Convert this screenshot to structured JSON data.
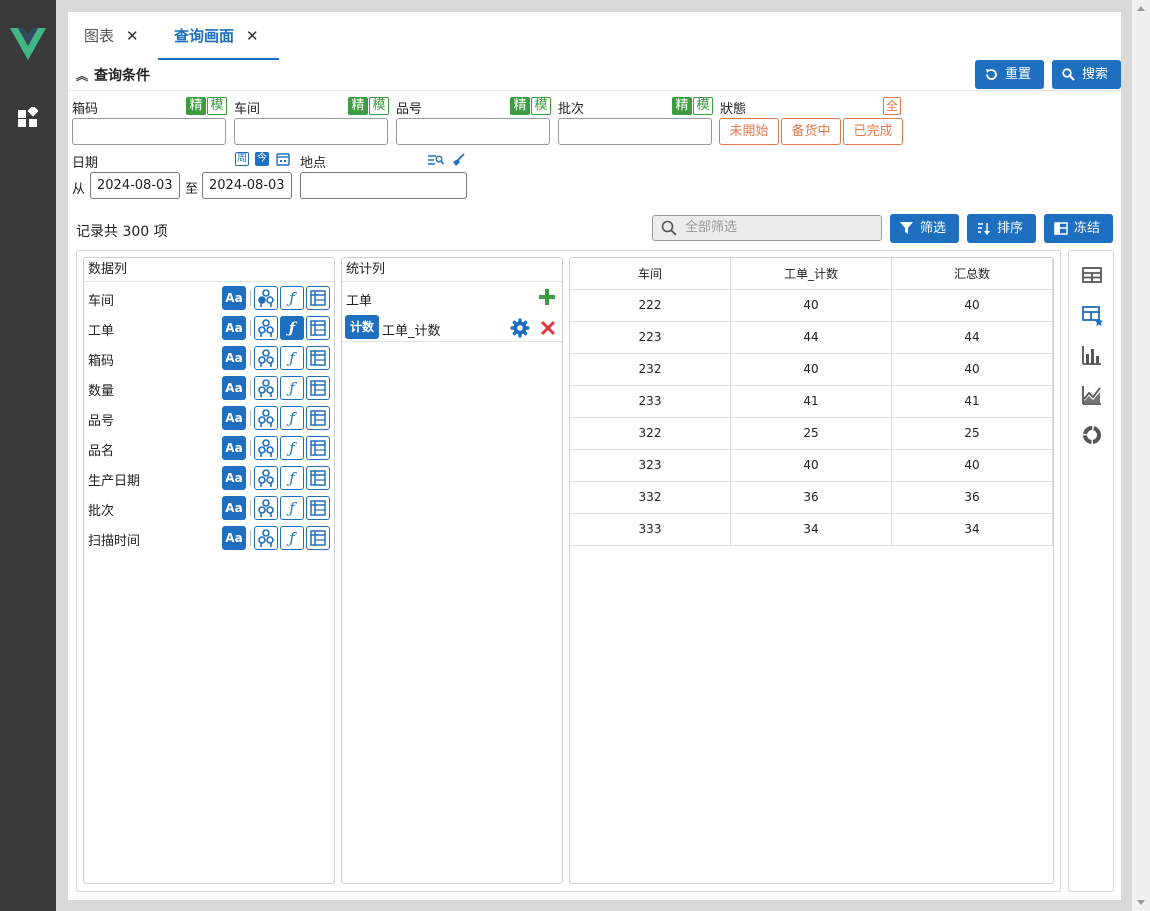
{
  "tabs": [
    {
      "label": "图表",
      "close": "✕"
    },
    {
      "label": "查询画面",
      "close": "✕"
    }
  ],
  "query": {
    "title": "查询条件",
    "reset_label": "重置",
    "search_label": "搜索",
    "fields": [
      {
        "label": "箱码",
        "exact": "精",
        "fuzzy": "模",
        "value": ""
      },
      {
        "label": "车间",
        "exact": "精",
        "fuzzy": "模",
        "value": ""
      },
      {
        "label": "品号",
        "exact": "精",
        "fuzzy": "模",
        "value": ""
      },
      {
        "label": "批次",
        "exact": "精",
        "fuzzy": "模",
        "value": ""
      }
    ],
    "status": {
      "label": "狀態",
      "all": "全",
      "options": [
        "未開始",
        "备货中",
        "已完成"
      ]
    },
    "date": {
      "label": "日期",
      "week": "周",
      "today": "今",
      "from_label": "从",
      "from": "2024-08-03",
      "to_label": "至",
      "to": "2024-08-03"
    },
    "location": {
      "label": "地点",
      "value": ""
    }
  },
  "toolbar": {
    "records": "记录共 300 项",
    "filter_all_placeholder": "全部筛选",
    "filter_label": "筛选",
    "sort_label": "排序",
    "freeze_label": "冻结"
  },
  "data_columns": {
    "header": "数据列",
    "items": [
      "车间",
      "工单",
      "箱码",
      "数量",
      "品号",
      "品名",
      "生产日期",
      "批次",
      "扫描时间"
    ],
    "aa": "Aa",
    "func": "ƒ"
  },
  "stat_columns": {
    "header": "统计列",
    "group_label": "工单",
    "count_badge": "计数",
    "count_label": "工单_计数"
  },
  "result_table": {
    "headers": [
      "车间",
      "工单_计数",
      "汇总数"
    ],
    "rows": [
      [
        "222",
        "40",
        "40"
      ],
      [
        "223",
        "44",
        "44"
      ],
      [
        "232",
        "40",
        "40"
      ],
      [
        "233",
        "41",
        "41"
      ],
      [
        "322",
        "25",
        "25"
      ],
      [
        "323",
        "40",
        "40"
      ],
      [
        "332",
        "36",
        "36"
      ],
      [
        "333",
        "34",
        "34"
      ]
    ]
  },
  "colors": {
    "primary": "#1e6fc0",
    "green": "#3d9c3f",
    "orange": "#e07a4b",
    "red": "#e53935",
    "sidebar": "#3a3a3a"
  }
}
